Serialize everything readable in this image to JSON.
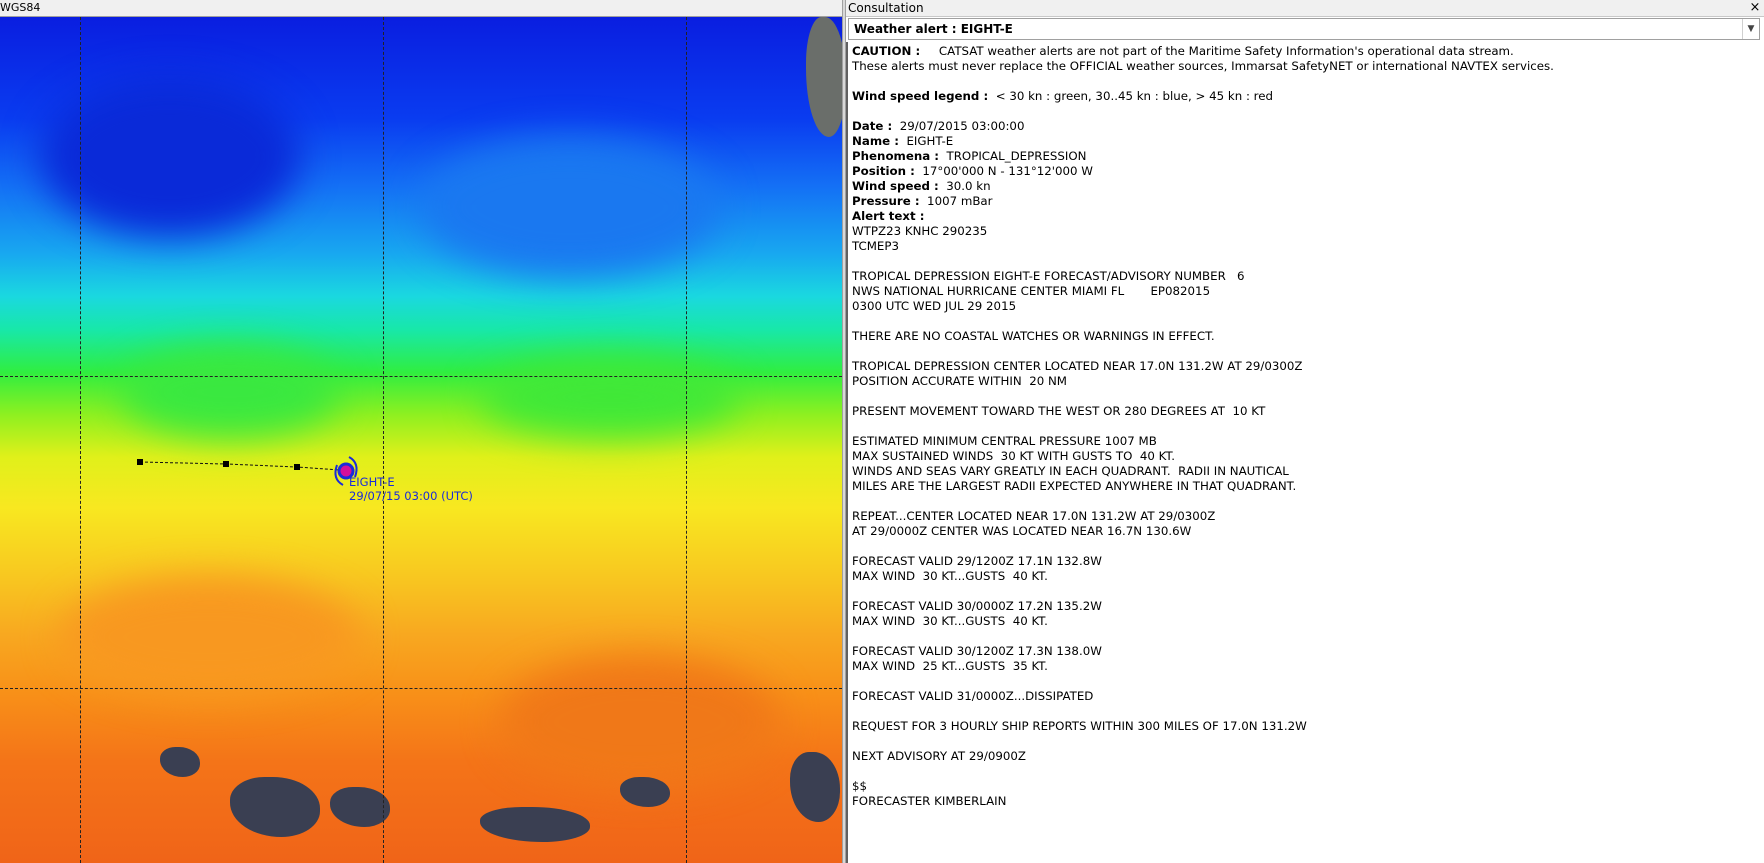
{
  "map": {
    "title": "WGS84",
    "storm": {
      "name": "EIGHT-E",
      "datetime": "29/07/15 03:00 (UTC)"
    }
  },
  "consultation": {
    "window_title": "Consultation",
    "close_symbol": "×",
    "selected_alert": "Weather alert : EIGHT-E",
    "caution_label": "CAUTION :",
    "caution_text_1": "CATSAT weather alerts are not part of the Maritime Safety Information's operational data stream.",
    "caution_text_2": "These alerts must never replace the OFFICIAL weather sources, Immarsat SafetyNET or international NAVTEX services.",
    "legend_label": "Wind speed legend :",
    "legend_text": "< 30 kn : green, 30..45 kn : blue, > 45 kn : red",
    "fields": [
      {
        "label": "Date :",
        "value": "29/07/2015 03:00:00"
      },
      {
        "label": "Name :",
        "value": "EIGHT-E"
      },
      {
        "label": "Phenomena :",
        "value": "TROPICAL_DEPRESSION"
      },
      {
        "label": "Position :",
        "value": "17°00'000 N - 131°12'000 W"
      },
      {
        "label": "Wind speed :",
        "value": "30.0 kn"
      },
      {
        "label": "Pressure :",
        "value": "1007 mBar"
      }
    ],
    "alert_text_label": "Alert text :",
    "alert_lines": [
      "WTPZ23 KNHC 290235",
      "TCMEP3",
      "",
      "TROPICAL DEPRESSION EIGHT-E FORECAST/ADVISORY NUMBER   6",
      "NWS NATIONAL HURRICANE CENTER MIAMI FL       EP082015",
      "0300 UTC WED JUL 29 2015",
      "",
      "THERE ARE NO COASTAL WATCHES OR WARNINGS IN EFFECT.",
      "",
      "TROPICAL DEPRESSION CENTER LOCATED NEAR 17.0N 131.2W AT 29/0300Z",
      "POSITION ACCURATE WITHIN  20 NM",
      "",
      "PRESENT MOVEMENT TOWARD THE WEST OR 280 DEGREES AT  10 KT",
      "",
      "ESTIMATED MINIMUM CENTRAL PRESSURE 1007 MB",
      "MAX SUSTAINED WINDS  30 KT WITH GUSTS TO  40 KT.",
      "WINDS AND SEAS VARY GREATLY IN EACH QUADRANT.  RADII IN NAUTICAL",
      "MILES ARE THE LARGEST RADII EXPECTED ANYWHERE IN THAT QUADRANT.",
      "",
      "REPEAT...CENTER LOCATED NEAR 17.0N 131.2W AT 29/0300Z",
      "AT 29/0000Z CENTER WAS LOCATED NEAR 16.7N 130.6W",
      "",
      "FORECAST VALID 29/1200Z 17.1N 132.8W",
      "MAX WIND  30 KT...GUSTS  40 KT.",
      "",
      "FORECAST VALID 30/0000Z 17.2N 135.2W",
      "MAX WIND  30 KT...GUSTS  40 KT.",
      "",
      "FORECAST VALID 30/1200Z 17.3N 138.0W",
      "MAX WIND  25 KT...GUSTS  35 KT.",
      "",
      "FORECAST VALID 31/0000Z...DISSIPATED",
      "",
      "REQUEST FOR 3 HOURLY SHIP REPORTS WITHIN 300 MILES OF 17.0N 131.2W",
      "",
      "NEXT ADVISORY AT 29/0900Z",
      "",
      "$$",
      "FORECASTER KIMBERLAIN"
    ]
  }
}
